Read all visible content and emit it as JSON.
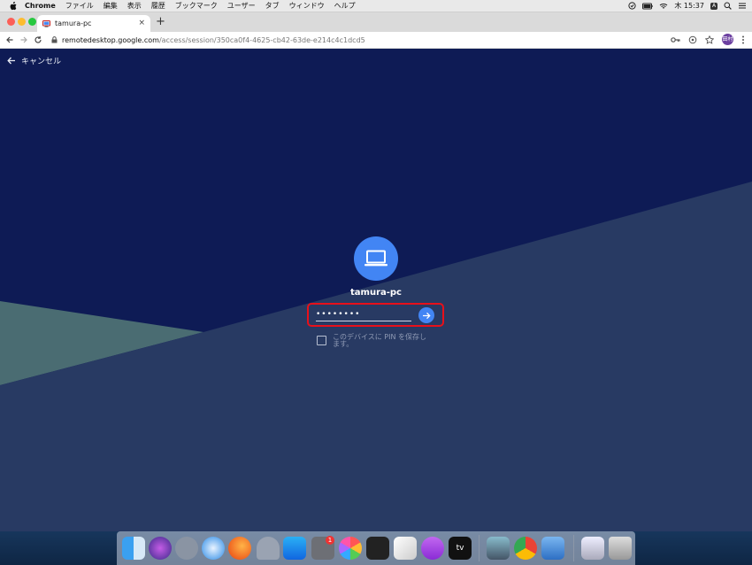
{
  "menubar": {
    "app_name": "Chrome",
    "items": [
      "ファイル",
      "編集",
      "表示",
      "履歴",
      "ブックマーク",
      "ユーザー",
      "タブ",
      "ウィンドウ",
      "ヘルプ"
    ],
    "clock": "木 15:37",
    "input_method": "A"
  },
  "tab": {
    "title": "tamura-pc",
    "close_glyph": "×",
    "new_tab_glyph": "+"
  },
  "address_bar": {
    "host": "remotedesktop.google.com",
    "path": "/access/session/350ca0f4-4625-cb42-63de-e214c4c1dcd5"
  },
  "profile": {
    "avatar_text": "田村"
  },
  "page": {
    "cancel_label": "キャンセル",
    "host_name": "tamura-pc",
    "pin_value": "••••••••",
    "remember_label": "このデバイスに PIN を保存します。",
    "colors": {
      "background_dark": "#0e1b55",
      "background_light": "#283a63",
      "accent_blue": "#4285f4",
      "highlight_red": "#e8101a"
    }
  },
  "dock": {
    "notification_badge": "1",
    "tv_label": "tv"
  }
}
